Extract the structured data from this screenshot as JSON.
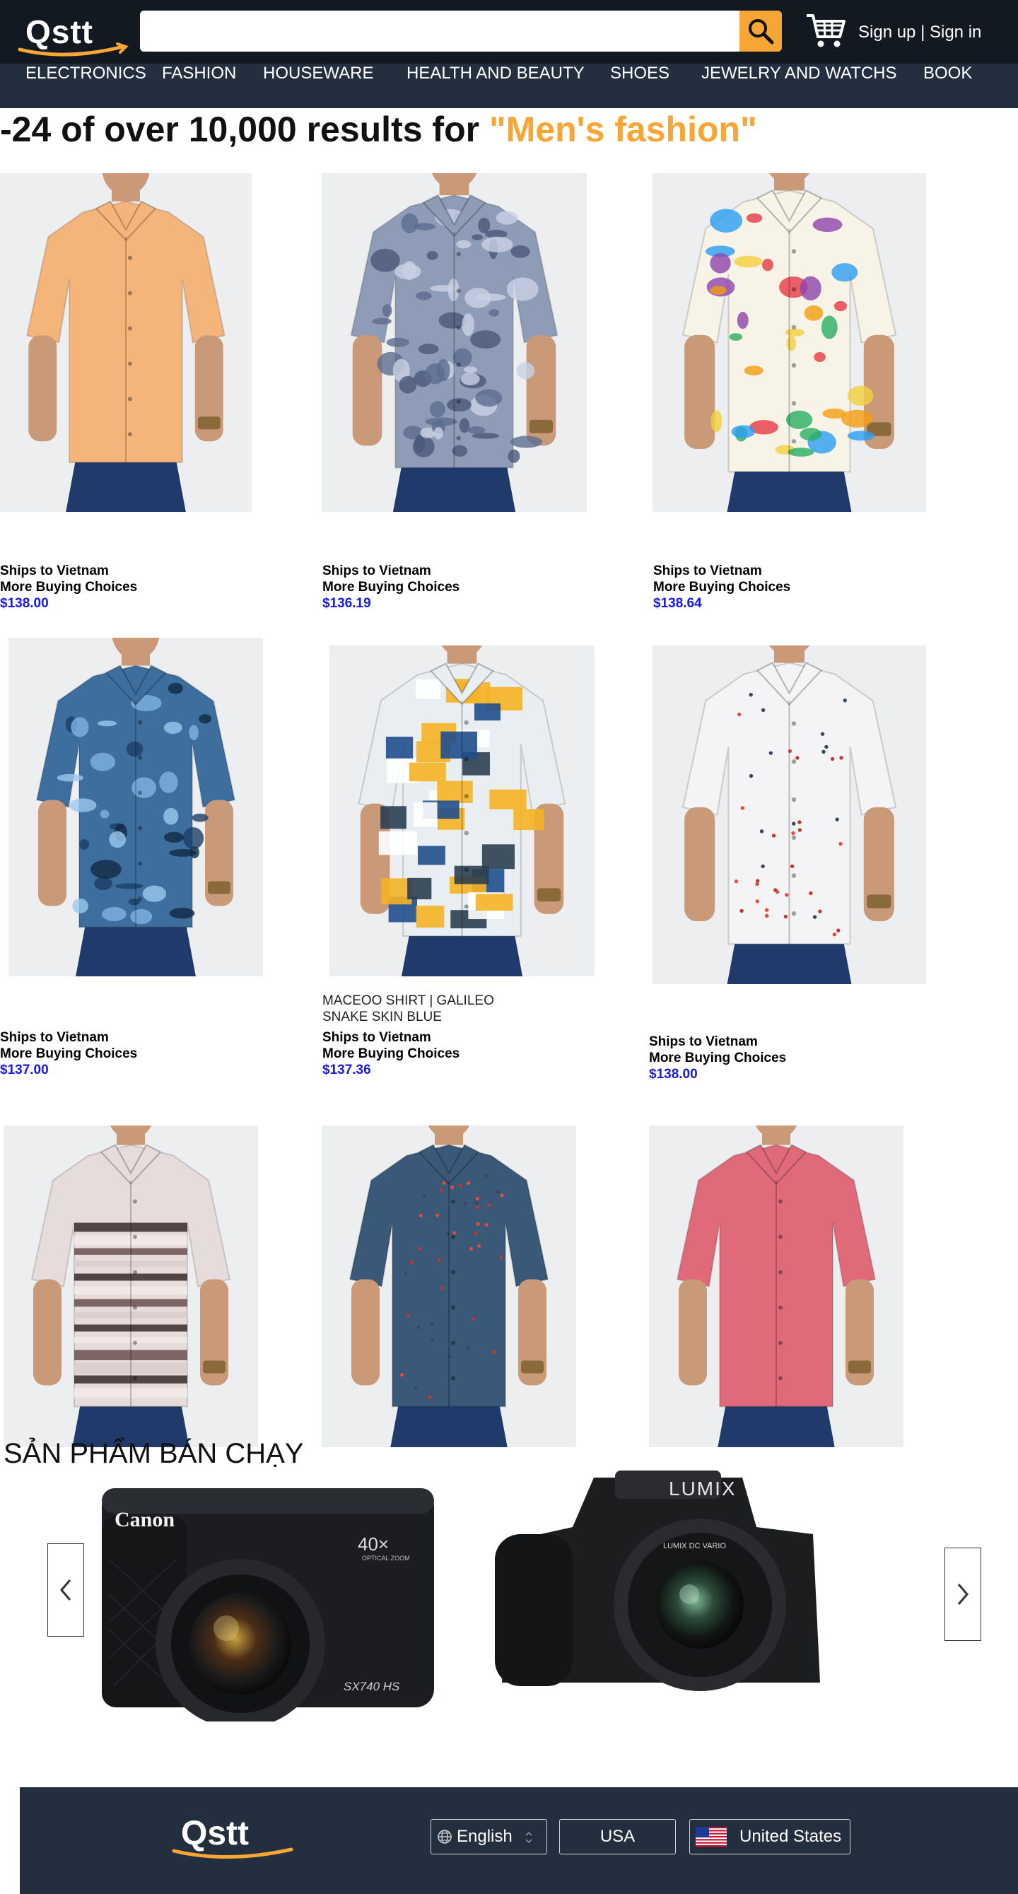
{
  "header": {
    "logo": "Qstt",
    "search": {
      "value": "",
      "placeholder": ""
    },
    "auth": {
      "sign_up": "Sign up",
      "separator": " | ",
      "sign_in": "Sign in"
    }
  },
  "nav": [
    "ELECTRONICS",
    "FASHION",
    "HOUSEWARE",
    "HEALTH AND BEAUTY",
    "SHOES",
    "JEWELRY AND WATCHS",
    "BOOK"
  ],
  "results": {
    "prefix": "-24 of over 10,000 results for ",
    "query": "\"Men's fashion\""
  },
  "products": [
    {
      "name": "",
      "shipping": "Ships to Vietnam",
      "more": "More Buying Choices",
      "price": "$138.00",
      "shirt_color": "#f5b57a",
      "pattern": "solid"
    },
    {
      "name": "",
      "shipping": "Ships to Vietnam",
      "more": "More Buying Choices",
      "price": "$136.19",
      "shirt_color": "#8f9cb8",
      "pattern": "paisley"
    },
    {
      "name": "",
      "shipping": "Ships to Vietnam",
      "more": "More Buying Choices",
      "price": "$138.64",
      "shirt_color": "#f7f3e6",
      "pattern": "splash"
    },
    {
      "name": "",
      "shipping": "Ships to Vietnam",
      "more": "More Buying Choices",
      "price": "$137.00",
      "shirt_color": "#3d6e9e",
      "pattern": "abstract"
    },
    {
      "name": "MACEOO SHIRT | GALILEO SNAKE SKIN BLUE",
      "shipping": "Ships to Vietnam",
      "more": "More Buying Choices",
      "price": "$137.36",
      "shirt_color": "#e8eef2",
      "pattern": "blocks"
    },
    {
      "name": "",
      "shipping": "Ships to Vietnam",
      "more": "More Buying Choices",
      "price": "$138.00",
      "shirt_color": "#f4f4f6",
      "pattern": "dots"
    },
    {
      "name": "",
      "shipping": "",
      "more": "",
      "price": "",
      "shirt_color": "#e6dcdc",
      "pattern": "stripes"
    },
    {
      "name": "",
      "shipping": "",
      "more": "",
      "price": "",
      "shirt_color": "#3a5878",
      "pattern": "dots"
    },
    {
      "name": "",
      "shipping": "",
      "more": "",
      "price": "",
      "shirt_color": "#e06a7a",
      "pattern": "solid"
    }
  ],
  "best_sellers": {
    "title": "SẢN PHẨM BÁN CHẠY",
    "items": [
      {
        "brand": "Canon",
        "zoom": "40×",
        "zoom_sub": "OPTICAL ZOOM",
        "model": "SX740 HS"
      },
      {
        "brand": "LUMIX",
        "lens": "LUMIX DC VARIO"
      }
    ]
  },
  "footer": {
    "logo": "Qstt",
    "language": "English",
    "currency": "USA",
    "country": "United States"
  },
  "colors": {
    "header_bg": "#131921",
    "nav_bg": "#232f3e",
    "accent": "#f7a535",
    "price": "#1717e8"
  }
}
